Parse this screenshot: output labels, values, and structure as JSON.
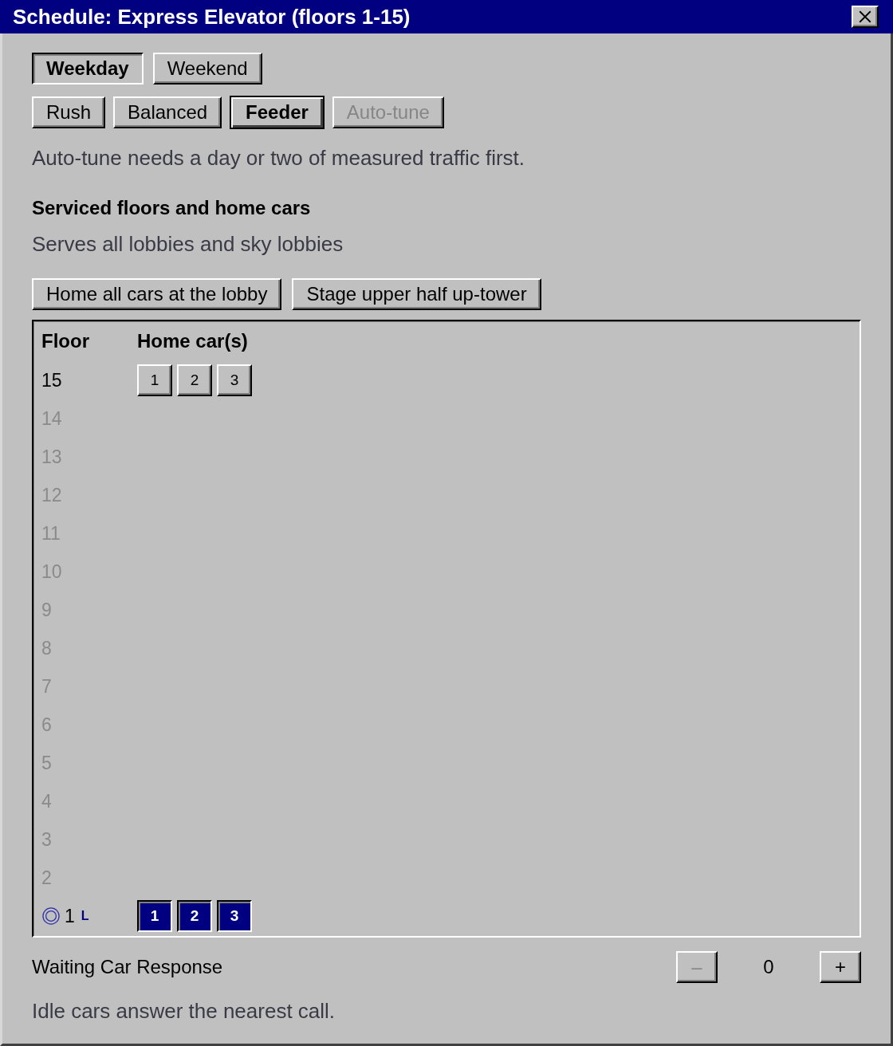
{
  "window": {
    "title": "Schedule: Express Elevator (floors 1-15)"
  },
  "day_tabs": [
    {
      "label": "Weekday",
      "selected": true
    },
    {
      "label": "Weekend",
      "selected": false
    }
  ],
  "modes": [
    {
      "label": "Rush",
      "selected": false,
      "disabled": false
    },
    {
      "label": "Balanced",
      "selected": false,
      "disabled": false
    },
    {
      "label": "Feeder",
      "selected": true,
      "disabled": false
    },
    {
      "label": "Auto-tune",
      "selected": false,
      "disabled": true
    }
  ],
  "mode_hint": "Auto-tune needs a day or two of measured traffic first.",
  "service": {
    "heading": "Serviced floors and home cars",
    "summary": "Serves all lobbies and sky lobbies",
    "actions": [
      "Home all cars at the lobby",
      "Stage upper half up-tower"
    ],
    "table": {
      "columns": [
        "Floor",
        "Home car(s)"
      ],
      "floors": [
        {
          "label": "15",
          "serviced": true,
          "main_lobby": false,
          "cars": [
            {
              "label": "1",
              "selected": false
            },
            {
              "label": "2",
              "selected": false
            },
            {
              "label": "3",
              "selected": false
            }
          ]
        },
        {
          "label": "14",
          "serviced": false,
          "main_lobby": false
        },
        {
          "label": "13",
          "serviced": false,
          "main_lobby": false
        },
        {
          "label": "12",
          "serviced": false,
          "main_lobby": false
        },
        {
          "label": "11",
          "serviced": false,
          "main_lobby": false
        },
        {
          "label": "10",
          "serviced": false,
          "main_lobby": false
        },
        {
          "label": "9",
          "serviced": false,
          "main_lobby": false
        },
        {
          "label": "8",
          "serviced": false,
          "main_lobby": false
        },
        {
          "label": "7",
          "serviced": false,
          "main_lobby": false
        },
        {
          "label": "6",
          "serviced": false,
          "main_lobby": false
        },
        {
          "label": "5",
          "serviced": false,
          "main_lobby": false
        },
        {
          "label": "4",
          "serviced": false,
          "main_lobby": false
        },
        {
          "label": "3",
          "serviced": false,
          "main_lobby": false
        },
        {
          "label": "2",
          "serviced": false,
          "main_lobby": false
        },
        {
          "label": "1",
          "serviced": true,
          "main_lobby": true,
          "badge": "L",
          "cars": [
            {
              "label": "1",
              "selected": true
            },
            {
              "label": "2",
              "selected": true
            },
            {
              "label": "3",
              "selected": true
            }
          ]
        }
      ]
    }
  },
  "waiting_response": {
    "label": "Waiting Car Response",
    "decrement": {
      "label": "–",
      "disabled": true
    },
    "value": "0",
    "increment": {
      "label": "+",
      "disabled": false
    },
    "hint": "Idle cars answer the nearest call."
  }
}
